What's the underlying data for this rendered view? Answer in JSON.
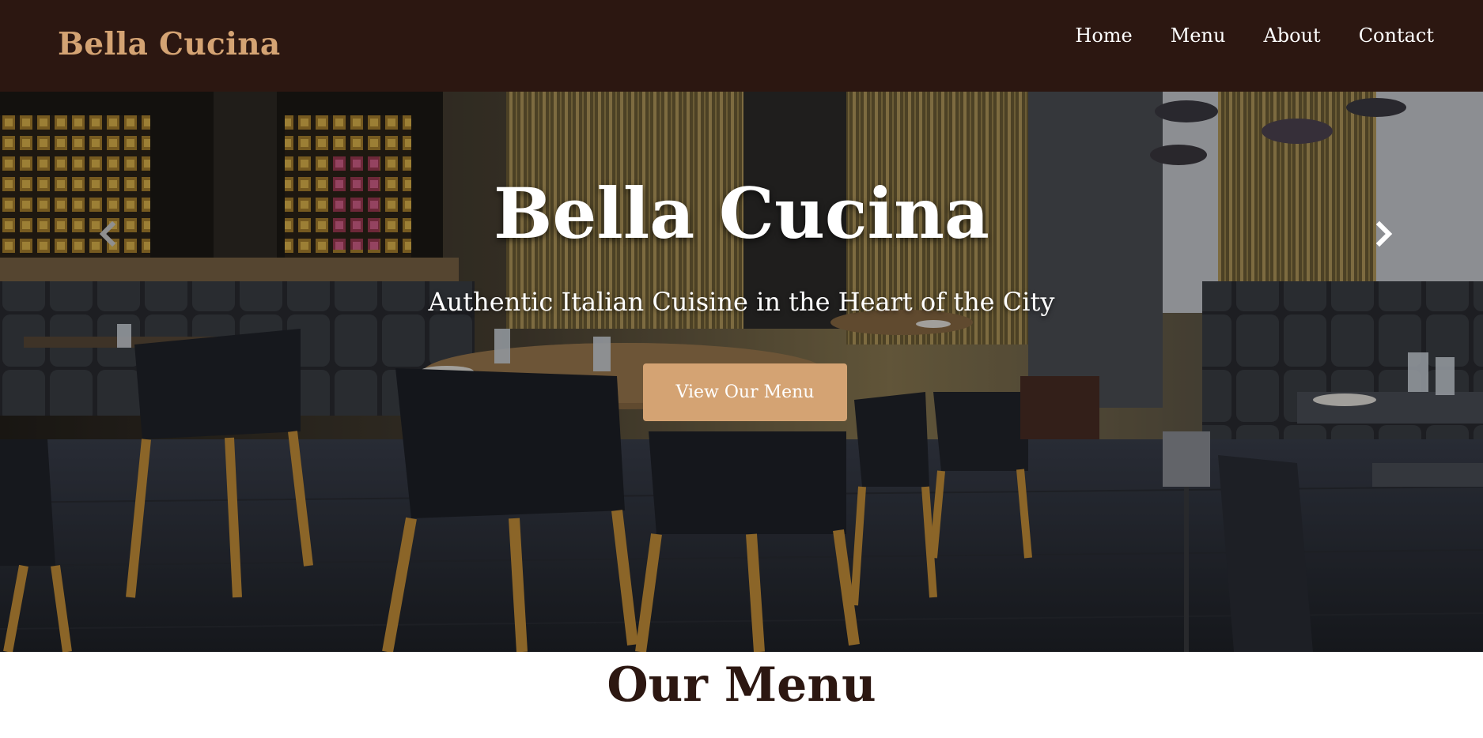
{
  "header": {
    "brand": "Bella Cucina",
    "nav": [
      {
        "label": "Home"
      },
      {
        "label": "Menu"
      },
      {
        "label": "About"
      },
      {
        "label": "Contact"
      }
    ]
  },
  "hero": {
    "title": "Bella Cucina",
    "subtitle": "Authentic Italian Cuisine in the Heart of the City",
    "cta_label": "View Our Menu",
    "prev_icon": "chevron-left-icon",
    "next_icon": "chevron-right-icon",
    "image_alt": "restaurant-dining-room-photo"
  },
  "menu_section": {
    "heading": "Our Menu"
  },
  "colors": {
    "header_bg": "#2c1711",
    "accent": "#d4a373",
    "heading_text": "#2c1711"
  }
}
